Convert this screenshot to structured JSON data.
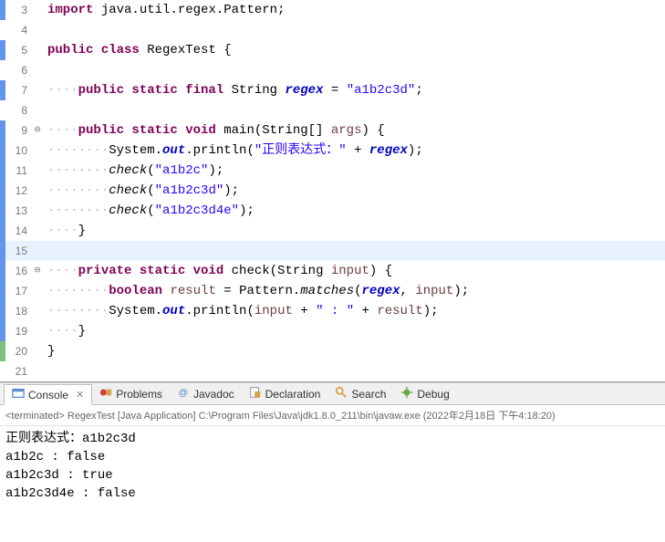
{
  "editor": {
    "lines": [
      {
        "num": 3,
        "marker": "blue",
        "fold": "",
        "tokens": [
          [
            "kw",
            "import"
          ],
          [
            "",
            " java.util.regex.Pattern;"
          ]
        ]
      },
      {
        "num": 4,
        "marker": "",
        "fold": "",
        "tokens": []
      },
      {
        "num": 5,
        "marker": "blue",
        "fold": "",
        "tokens": [
          [
            "kw",
            "public class"
          ],
          [
            "",
            " RegexTest {"
          ]
        ]
      },
      {
        "num": 6,
        "marker": "",
        "fold": "",
        "tokens": []
      },
      {
        "num": 7,
        "marker": "blue",
        "fold": "",
        "tokens": [
          [
            "ws-dots",
            "····"
          ],
          [
            "kw",
            "public static final"
          ],
          [
            "",
            " String "
          ],
          [
            "fld",
            "regex"
          ],
          [
            "",
            " = "
          ],
          [
            "str",
            "\"a1b2c3d\""
          ],
          [
            "",
            ";"
          ]
        ]
      },
      {
        "num": 8,
        "marker": "",
        "fold": "",
        "tokens": []
      },
      {
        "num": 9,
        "marker": "blue",
        "fold": "⊖",
        "tokens": [
          [
            "ws-dots",
            "····"
          ],
          [
            "kw",
            "public static void"
          ],
          [
            "",
            " main(String[] "
          ],
          [
            "param",
            "args"
          ],
          [
            "",
            ") {"
          ]
        ]
      },
      {
        "num": 10,
        "marker": "blue",
        "fold": "",
        "tokens": [
          [
            "ws-dots",
            "········"
          ],
          [
            "",
            "System."
          ],
          [
            "fld",
            "out"
          ],
          [
            "",
            ".println("
          ],
          [
            "str",
            "\"正则表达式：\""
          ],
          [
            "",
            " + "
          ],
          [
            "fld",
            "regex"
          ],
          [
            "",
            ");"
          ]
        ]
      },
      {
        "num": 11,
        "marker": "blue",
        "fold": "",
        "tokens": [
          [
            "ws-dots",
            "········"
          ],
          [
            "mtd-static",
            "check"
          ],
          [
            "",
            "("
          ],
          [
            "str",
            "\"a1b2c\""
          ],
          [
            "",
            ");"
          ]
        ]
      },
      {
        "num": 12,
        "marker": "blue",
        "fold": "",
        "tokens": [
          [
            "ws-dots",
            "········"
          ],
          [
            "mtd-static",
            "check"
          ],
          [
            "",
            "("
          ],
          [
            "str",
            "\"a1b2c3d\""
          ],
          [
            "",
            ");"
          ]
        ]
      },
      {
        "num": 13,
        "marker": "blue",
        "fold": "",
        "tokens": [
          [
            "ws-dots",
            "········"
          ],
          [
            "mtd-static",
            "check"
          ],
          [
            "",
            "("
          ],
          [
            "str",
            "\"a1b2c3d4e\""
          ],
          [
            "",
            ");"
          ]
        ]
      },
      {
        "num": 14,
        "marker": "blue",
        "fold": "",
        "tokens": [
          [
            "ws-dots",
            "····"
          ],
          [
            "",
            "}"
          ]
        ]
      },
      {
        "num": 15,
        "marker": "blue",
        "fold": "",
        "highlight": true,
        "tokens": []
      },
      {
        "num": 16,
        "marker": "blue",
        "fold": "⊖",
        "tokens": [
          [
            "ws-dots",
            "····"
          ],
          [
            "kw",
            "private static void"
          ],
          [
            "",
            " check(String "
          ],
          [
            "param",
            "input"
          ],
          [
            "",
            ") {"
          ]
        ]
      },
      {
        "num": 17,
        "marker": "blue",
        "fold": "",
        "tokens": [
          [
            "ws-dots",
            "········"
          ],
          [
            "kw",
            "boolean"
          ],
          [
            "",
            " "
          ],
          [
            "param",
            "result"
          ],
          [
            "",
            " = Pattern."
          ],
          [
            "mtd-static",
            "matches"
          ],
          [
            "",
            "("
          ],
          [
            "fld",
            "regex"
          ],
          [
            "",
            ", "
          ],
          [
            "param",
            "input"
          ],
          [
            "",
            ");"
          ]
        ]
      },
      {
        "num": 18,
        "marker": "blue",
        "fold": "",
        "tokens": [
          [
            "ws-dots",
            "········"
          ],
          [
            "",
            "System."
          ],
          [
            "fld",
            "out"
          ],
          [
            "",
            ".println("
          ],
          [
            "param",
            "input"
          ],
          [
            "",
            " + "
          ],
          [
            "str",
            "\" : \""
          ],
          [
            "",
            " + "
          ],
          [
            "param",
            "result"
          ],
          [
            "",
            ");"
          ]
        ]
      },
      {
        "num": 19,
        "marker": "blue",
        "fold": "",
        "tokens": [
          [
            "ws-dots",
            "····"
          ],
          [
            "",
            "}"
          ]
        ]
      },
      {
        "num": 20,
        "marker": "green",
        "fold": "",
        "tokens": [
          [
            "",
            "}"
          ]
        ]
      },
      {
        "num": 21,
        "marker": "",
        "fold": "",
        "tokens": []
      }
    ]
  },
  "tabs": {
    "items": [
      {
        "label": "Console",
        "icon": "console",
        "active": true,
        "closable": true
      },
      {
        "label": "Problems",
        "icon": "problems",
        "active": false,
        "closable": false
      },
      {
        "label": "Javadoc",
        "icon": "javadoc",
        "active": false,
        "closable": false
      },
      {
        "label": "Declaration",
        "icon": "decl",
        "active": false,
        "closable": false
      },
      {
        "label": "Search",
        "icon": "search",
        "active": false,
        "closable": false
      },
      {
        "label": "Debug",
        "icon": "debug",
        "active": false,
        "closable": false
      }
    ]
  },
  "console": {
    "header": "<terminated> RegexTest [Java Application] C:\\Program Files\\Java\\jdk1.8.0_211\\bin\\javaw.exe (2022年2月18日 下午4:18:20)",
    "lines": [
      "正则表达式：a1b2c3d",
      "a1b2c : false",
      "a1b2c3d : true",
      "a1b2c3d4e : false"
    ]
  }
}
